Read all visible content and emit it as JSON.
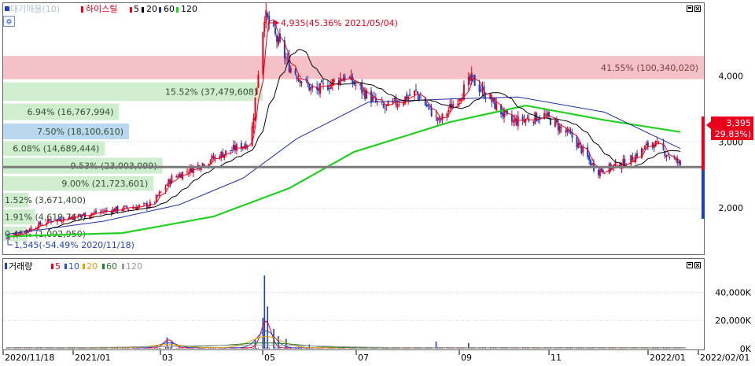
{
  "colors": {
    "up": "#e8001c",
    "down": "#1f3fbf",
    "ma5": "#e8001c",
    "ma20": "#000000",
    "ma60": "#1f2fa0",
    "ma120": "#22d022",
    "vol_ma5": "#e8001c",
    "vol_ma10": "#2a4fd0",
    "vol_ma20": "#e8a000",
    "vol_ma60": "#2a7a2a",
    "vol_ma120": "#9a9a9a",
    "profile_green": "#cfeed0",
    "profile_blue": "#b9d8f0",
    "profile_pink": "#f3c1c6",
    "current_line": "#7a7a7a",
    "grid": "#c9d6e6"
  },
  "price_legend": {
    "main": "대기매물(10)",
    "indicator": "하이스틸",
    "ma": [
      "5",
      "20",
      "60",
      "120"
    ]
  },
  "volume_legend": {
    "main": "거래량",
    "ma": [
      "5",
      "10",
      "20",
      "60",
      "120"
    ]
  },
  "annotations": {
    "high": "4,935(45.36% 2021/05/04)",
    "low": "1,545(-54.49% 2020/11/18)",
    "current_price": "3,395",
    "current_change": "( 29.83%)"
  },
  "chart_data": [
    {
      "type": "candlestick",
      "title": "하이스틸",
      "x_range": [
        "2020/11/18",
        "2022/02/01"
      ],
      "x_tick_labels": [
        "2020/11/18",
        "2021/01",
        "03",
        "05",
        "07",
        "09",
        "11",
        "2022/01",
        "2022/02/01"
      ],
      "y_tick_labels": [
        "4,000",
        "3,000",
        "2,000"
      ],
      "ylim": [
        1300,
        5100
      ],
      "series": [
        {
          "name": "5",
          "values": []
        },
        {
          "name": "20",
          "values": []
        },
        {
          "name": "60",
          "values": []
        },
        {
          "name": "120",
          "values": []
        }
      ],
      "price_anchors": [
        {
          "date": "2020/11/18",
          "value": 1545
        },
        {
          "date": "2020/12/15",
          "value": 1800
        },
        {
          "date": "2021/01/20",
          "value": 1950
        },
        {
          "date": "2021/02/20",
          "value": 2050
        },
        {
          "date": "2021/03/05",
          "value": 2450
        },
        {
          "date": "2021/04/05",
          "value": 2800
        },
        {
          "date": "2021/04/25",
          "value": 3000
        },
        {
          "date": "2021/05/04",
          "value": 4935
        },
        {
          "date": "2021/05/20",
          "value": 4150
        },
        {
          "date": "2021/06/05",
          "value": 3750
        },
        {
          "date": "2021/06/25",
          "value": 4000
        },
        {
          "date": "2021/07/20",
          "value": 3500
        },
        {
          "date": "2021/08/10",
          "value": 3750
        },
        {
          "date": "2021/08/25",
          "value": 3300
        },
        {
          "date": "2021/09/15",
          "value": 3950
        },
        {
          "date": "2021/10/10",
          "value": 3300
        },
        {
          "date": "2021/11/01",
          "value": 3400
        },
        {
          "date": "2021/11/20",
          "value": 3050
        },
        {
          "date": "2021/12/05",
          "value": 2550
        },
        {
          "date": "2021/12/25",
          "value": 2700
        },
        {
          "date": "2022/01/10",
          "value": 3000
        },
        {
          "date": "2022/01/28",
          "value": 2650
        }
      ],
      "ma120_anchors": [
        {
          "date": "2020/11/18",
          "value": 1570
        },
        {
          "date": "2021/02/01",
          "value": 1620
        },
        {
          "date": "2021/04/01",
          "value": 1870
        },
        {
          "date": "2021/05/20",
          "value": 2300
        },
        {
          "date": "2021/07/01",
          "value": 2850
        },
        {
          "date": "2021/09/01",
          "value": 3300
        },
        {
          "date": "2021/10/20",
          "value": 3550
        },
        {
          "date": "2021/12/10",
          "value": 3330
        },
        {
          "date": "2022/01/28",
          "value": 3150
        }
      ],
      "ma60_anchors": [
        {
          "date": "2020/11/18",
          "value": 1600
        },
        {
          "date": "2021/01/20",
          "value": 1800
        },
        {
          "date": "2021/03/10",
          "value": 2050
        },
        {
          "date": "2021/04/20",
          "value": 2450
        },
        {
          "date": "2021/05/25",
          "value": 3050
        },
        {
          "date": "2021/07/10",
          "value": 3600
        },
        {
          "date": "2021/09/01",
          "value": 3650
        },
        {
          "date": "2021/10/15",
          "value": 3680
        },
        {
          "date": "2021/12/10",
          "value": 3450
        },
        {
          "date": "2022/01/28",
          "value": 2900
        }
      ],
      "volume_profile": [
        {
          "label": "41.55% (100,340,020)",
          "low": 3950,
          "high": 4300,
          "color": "pink"
        },
        {
          "label": "15.52% (37,479,608)",
          "low": 3620,
          "high": 3900,
          "color": "green"
        },
        {
          "label": "6.94% (16,767,994)",
          "low": 3330,
          "high": 3580,
          "color": "green"
        },
        {
          "label": "7.50% (18,100,610)",
          "low": 3040,
          "high": 3280,
          "color": "blue"
        },
        {
          "label": "6.08% (14,689,444)",
          "low": 2790,
          "high": 3010,
          "color": "green"
        },
        {
          "label": "9.53% (23,003,099)",
          "low": 2520,
          "high": 2760,
          "color": "green"
        },
        {
          "label": "9.00% (21,723,601)",
          "low": 2260,
          "high": 2480,
          "color": "green"
        },
        {
          "label": "1.52% (3,671,400)",
          "low": 2010,
          "high": 2230,
          "color": "green"
        },
        {
          "label": "1.91% (4,619,760)",
          "low": 1750,
          "high": 1980,
          "color": "green"
        },
        {
          "label": "0.45% (1,092,950)",
          "low": 1500,
          "high": 1720,
          "color": "green"
        }
      ],
      "current_line": 2620
    },
    {
      "type": "bar",
      "title": "거래량",
      "x_range": [
        "2020/11/18",
        "2022/02/01"
      ],
      "y_tick_labels": [
        "40,000K",
        "20,000K",
        "0K"
      ],
      "ylim": [
        0,
        52000
      ],
      "series": [
        {
          "name": "5",
          "values": []
        },
        {
          "name": "10",
          "values": []
        },
        {
          "name": "20",
          "values": []
        },
        {
          "name": "60",
          "values": []
        },
        {
          "name": "120",
          "values": []
        }
      ],
      "spikes": [
        {
          "date": "2021/03/02",
          "value": 8000
        },
        {
          "date": "2021/03/05",
          "value": 5000
        },
        {
          "date": "2021/04/28",
          "value": 6000
        },
        {
          "date": "2021/05/03",
          "value": 22000
        },
        {
          "date": "2021/05/04",
          "value": 52000
        },
        {
          "date": "2021/05/06",
          "value": 30000
        },
        {
          "date": "2021/05/10",
          "value": 14000
        },
        {
          "date": "2021/05/13",
          "value": 9000
        },
        {
          "date": "2021/05/18",
          "value": 7000
        },
        {
          "date": "2021/06/02",
          "value": 3000
        },
        {
          "date": "2021/08/23",
          "value": 5000
        },
        {
          "date": "2021/09/13",
          "value": 4000
        }
      ]
    }
  ]
}
